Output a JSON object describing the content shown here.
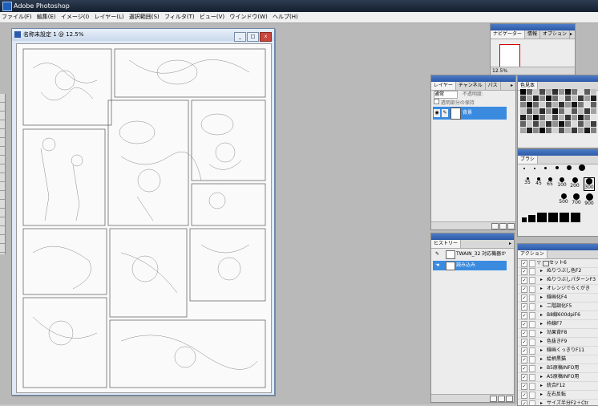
{
  "app": {
    "title": "Adobe Photoshop"
  },
  "menu": [
    "ファイル(F)",
    "編集(E)",
    "イメージ(I)",
    "レイヤー(L)",
    "選択範囲(S)",
    "フィルタ(T)",
    "ビュー(V)",
    "ウインドウ(W)",
    "ヘルプ(H)"
  ],
  "document": {
    "title": "名称未設定 1 @ 12.5%",
    "buttons": {
      "minimize": "_",
      "maximize": "□",
      "close": "x"
    }
  },
  "navigator": {
    "tabs": [
      "ナビゲーター",
      "情報",
      "オプション"
    ],
    "zoom": "12.5%"
  },
  "layers": {
    "tabs": [
      "レイヤー",
      "チャンネル",
      "パス"
    ],
    "blend_mode": "通常",
    "opacity_label": "不透明度:",
    "lock_label": "透明部分の保持",
    "rows": [
      {
        "name": "背景",
        "visible": true
      }
    ]
  },
  "swatches": {
    "tab": "色見本"
  },
  "brushes": {
    "tab": "ブラシ",
    "sizes": [
      "35",
      "45",
      "65",
      "100",
      "200",
      "300",
      "500",
      "700",
      "900"
    ],
    "selected": "300"
  },
  "history": {
    "tab": "ヒストリー",
    "items": [
      "TWAIN_32 対応機器から...",
      "読み込み"
    ],
    "selected": "読み込み"
  },
  "actions": {
    "tab": "アクション",
    "set_name": "セット6",
    "items": [
      "ぬりつぶし色F2",
      "ぬりつぶしパターンF3",
      "オレンジでらくがき",
      "線画化F4",
      "二階調化F5",
      "B8線600dpiF6",
      "枠線F7",
      "効果背F8",
      "色抜きF9",
      "線画くっきりF11",
      "絵柄黒猫",
      "B5原稿INFO用",
      "A5原稿INFO用",
      "統合F12",
      "左右反転",
      "サイズ半分F2＋Ctr"
    ]
  },
  "colors": {
    "accent": "#3a8be0",
    "titlebar": "#1d2a3a",
    "workspace": "#b9b9b9"
  }
}
